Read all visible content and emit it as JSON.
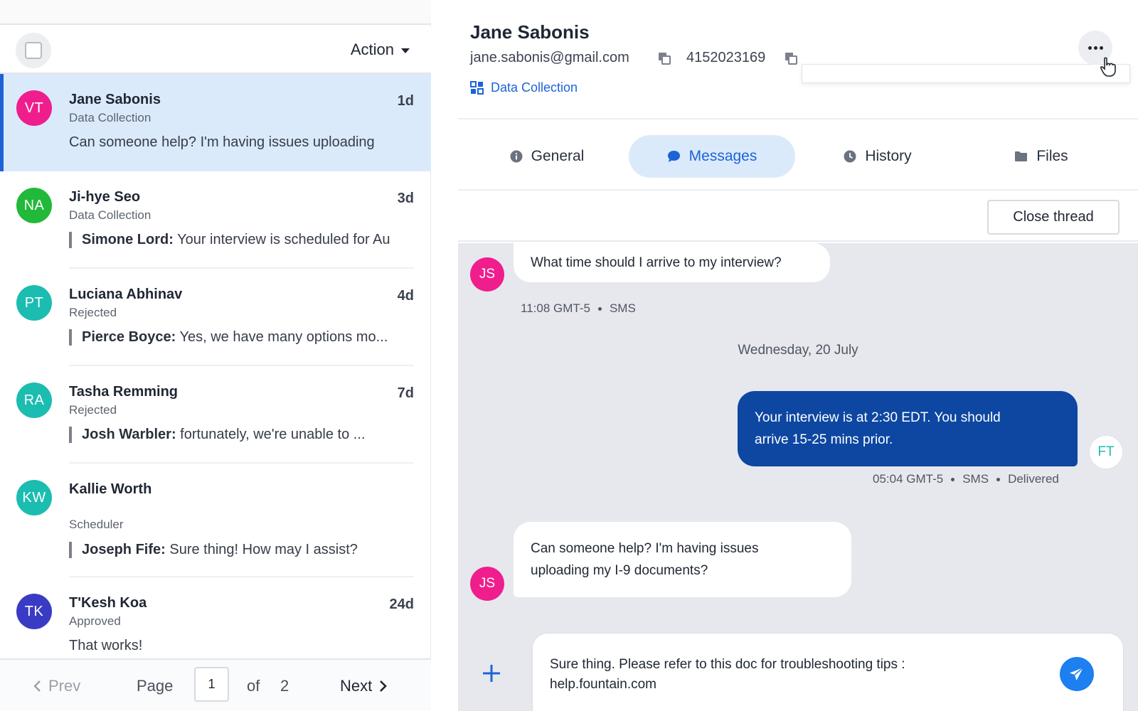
{
  "list_header": {
    "action_label": "Action"
  },
  "conversations": [
    {
      "initials": "VT",
      "avatar_color": "#f01e8c",
      "name": "Jane Sabonis",
      "age": "1d",
      "stage": "Data Collection",
      "sender": "",
      "preview": "Can someone help? I'm having issues uploading",
      "selected": true
    },
    {
      "initials": "NA",
      "avatar_color": "#22b83a",
      "name": "Ji-hye Seo",
      "age": "3d",
      "stage": "Data Collection",
      "sender": "Simone Lord:",
      "preview": " Your interview is scheduled for Au"
    },
    {
      "initials": "PT",
      "avatar_color": "#1bbdb0",
      "name": "Luciana Abhinav",
      "age": "4d",
      "stage": "Rejected",
      "sender": "Pierce Boyce:",
      "preview": " Yes, we have many options mo..."
    },
    {
      "initials": "RA",
      "avatar_color": "#1bbdb0",
      "name": "Tasha Remming",
      "age": "7d",
      "stage": "Rejected",
      "sender": "Josh Warbler:",
      "preview": " fortunately, we're unable to ..."
    },
    {
      "initials": "KW",
      "avatar_color": "#1bbdb0",
      "name": "Kallie Worth",
      "age": "",
      "stage": "Scheduler",
      "sender": "Joseph Fife:",
      "preview": " Sure thing! How may I assist?"
    },
    {
      "initials": "TK",
      "avatar_color": "#3a3bc4",
      "name": "T'Kesh Koa",
      "age": "24d",
      "stage": "Approved",
      "sender": "",
      "preview": "That works!"
    }
  ],
  "pager": {
    "prev_label": "Prev",
    "page_label": "Page",
    "current_page": "1",
    "of_label": "of",
    "total_pages": "2",
    "next_label": "Next"
  },
  "contact": {
    "name": "Jane Sabonis",
    "email": "jane.sabonis@gmail.com",
    "phone": "4152023169",
    "stage": "Data Collection"
  },
  "tabs": [
    {
      "label": "General",
      "icon": "info-icon"
    },
    {
      "label": "Messages",
      "icon": "chat-bubble-icon",
      "active": true
    },
    {
      "label": "History",
      "icon": "clock-icon"
    },
    {
      "label": "Files",
      "icon": "folder-icon"
    }
  ],
  "thread": {
    "close_label": "Close thread"
  },
  "messages": {
    "m1": {
      "initials": "JS",
      "text": "What time should I arrive to my interview?",
      "time": "11:08 GMT-5",
      "channel": "SMS"
    },
    "date_separator": "Wednesday, 20 July",
    "m2": {
      "initials": "FT",
      "line1": "Your interview is at 2:30 EDT. You should",
      "line2": "arrive 15-25 mins prior.",
      "time": "05:04 GMT-5",
      "channel": "SMS",
      "status": "Delivered"
    },
    "m3": {
      "initials": "JS",
      "line1": "Can someone help? I'm having issues",
      "line2": "uploading my I-9 documents?"
    }
  },
  "composer": {
    "line1": "Sure thing. Please refer to this doc for troubleshooting tips :",
    "line2": "help.fountain.com"
  },
  "colors": {
    "accent": "#1d63d6",
    "outgoing_bubble": "#0d47a1",
    "incoming_avatar": "#f01e8c",
    "send_button": "#1d7ff0"
  }
}
